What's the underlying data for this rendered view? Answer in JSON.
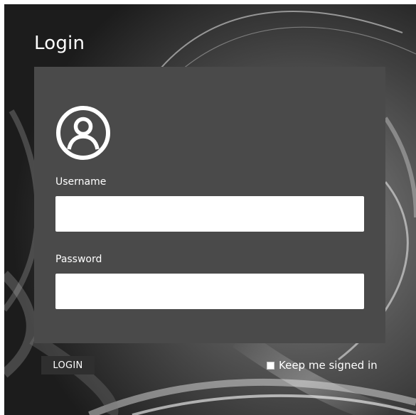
{
  "page": {
    "title": "Login"
  },
  "form": {
    "username_label": "Username",
    "username_value": "",
    "username_placeholder": "",
    "password_label": "Password",
    "password_value": "",
    "password_placeholder": "",
    "avatar_icon": "user-circle-icon"
  },
  "actions": {
    "login_label": "LOGIN",
    "keep_signed_label": "Keep me signed in",
    "keep_signed_checked": false
  },
  "colors": {
    "background": "#1e1e1e",
    "panel": "#4a4a4a",
    "button": "#2f2f2f",
    "text": "#ffffff"
  }
}
